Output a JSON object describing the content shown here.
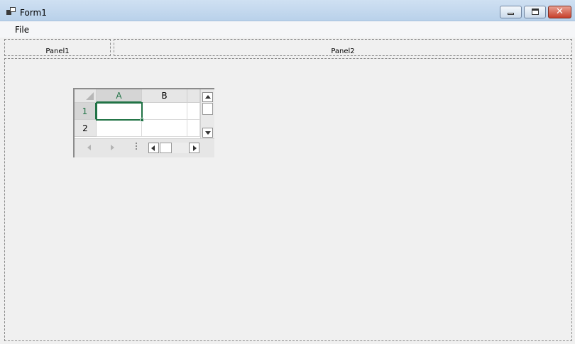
{
  "window": {
    "title": "Form1",
    "icon": "app-icon",
    "controls": {
      "minimize": "minimize-icon",
      "maximize": "maximize-icon",
      "close": "close-icon"
    }
  },
  "menu": {
    "items": [
      {
        "label": "File"
      }
    ]
  },
  "panels": {
    "panel1": "Panel1",
    "panel2": "Panel2"
  },
  "spreadsheet": {
    "columns": [
      "A",
      "B"
    ],
    "rows": [
      "1",
      "2"
    ],
    "active_cell": "A1",
    "cells": {
      "A1": "",
      "B1": "",
      "A2": "",
      "B2": ""
    },
    "accent_color": "#217346"
  }
}
